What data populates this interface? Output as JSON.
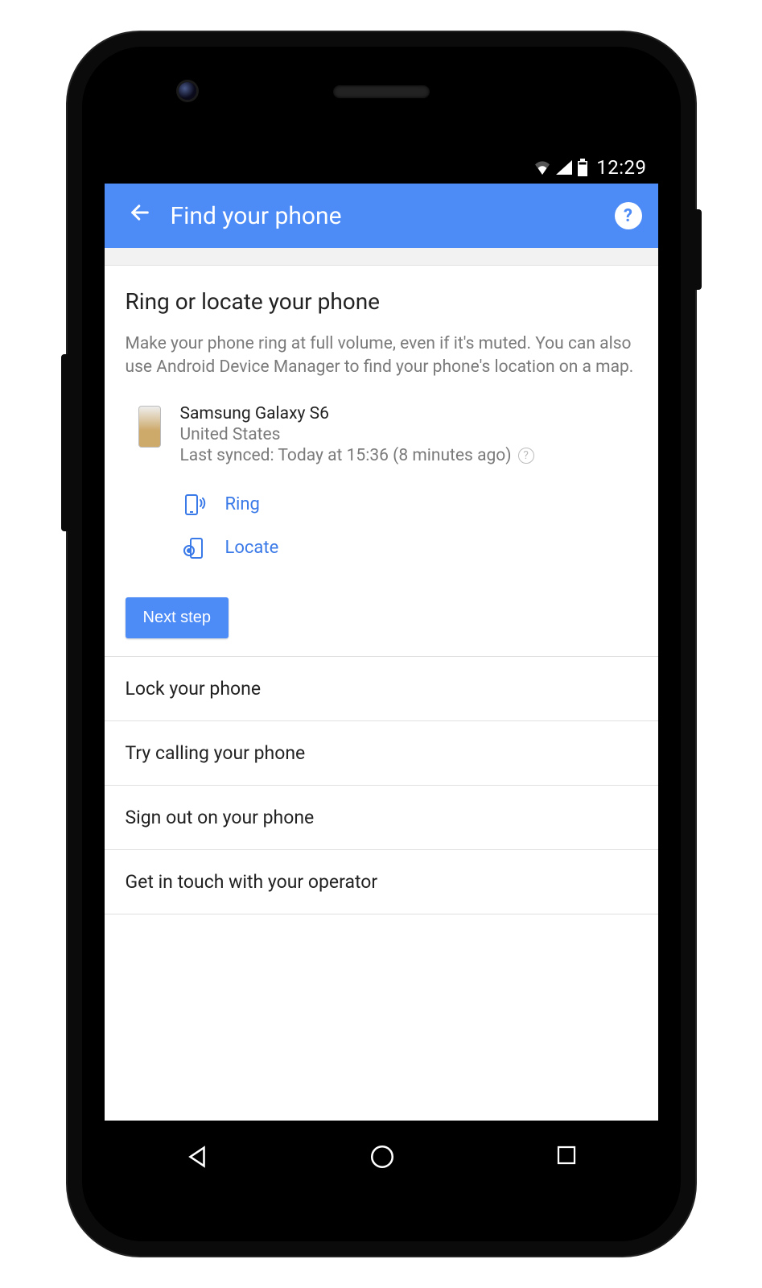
{
  "status": {
    "time": "12:29"
  },
  "appbar": {
    "title": "Find your phone"
  },
  "section": {
    "title": "Ring or locate your phone",
    "desc": "Make your phone ring at full volume, even if it's muted. You can also use Android Device Manager to find your phone's location on a map."
  },
  "device": {
    "name": "Samsung Galaxy S6",
    "location": "United States",
    "sync": "Last synced: Today at 15:36 (8 minutes ago)"
  },
  "actions": {
    "ring": "Ring",
    "locate": "Locate"
  },
  "next_step": "Next step",
  "options": [
    "Lock your phone",
    "Try calling your phone",
    "Sign out on your phone",
    "Get in touch with your operator"
  ]
}
